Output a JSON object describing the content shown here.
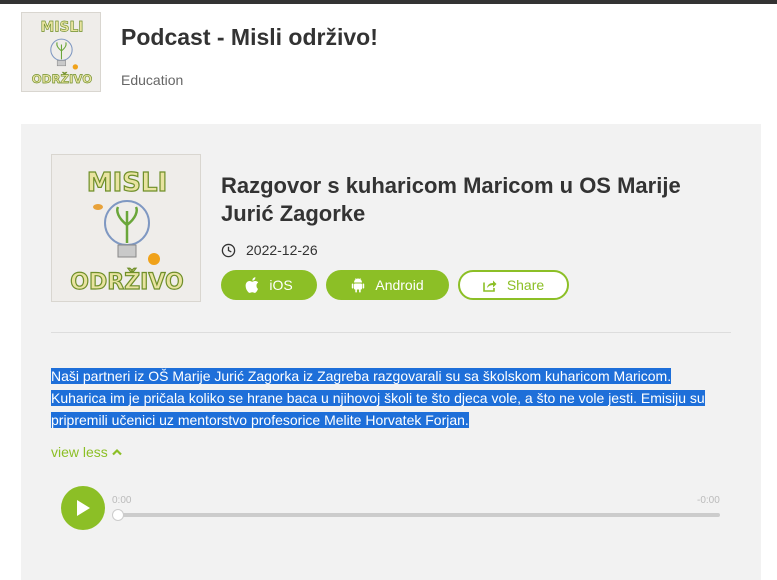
{
  "header": {
    "podcast_title": "Podcast - Misli održivo!",
    "category": "Education"
  },
  "artwork": {
    "line1": "MISLI",
    "line2": "ODRŽIVO"
  },
  "episode": {
    "title": "Razgovor s kuharicom Maricom u OS Marije Jurić Zagorke",
    "date": "2022-12-26",
    "buttons": {
      "ios": "iOS",
      "android": "Android",
      "share": "Share"
    },
    "description_lines": [
      "Naši partneri iz OŠ Marije Jurić Zagorka iz Zagreba razgovarali su sa školskom kuharicom Maricom.",
      "Kuharica im je pričala koliko se hrane baca u njihovoj školi te što djeca vole, a što ne vole jesti. Emisiju su",
      "pripremili učenici uz mentorstvo profesorice Melite Horvatek Forjan."
    ],
    "view_less": "view less"
  },
  "player": {
    "current_time": "0:00",
    "remaining_time": "-0:00",
    "progress": 0
  },
  "colors": {
    "accent": "#8cbf26",
    "selection": "#1e6fd9",
    "panel_bg": "#f2f2f2"
  },
  "icons": [
    "clock-icon",
    "apple-icon",
    "android-icon",
    "share-icon",
    "chevron-up-icon",
    "play-icon"
  ]
}
